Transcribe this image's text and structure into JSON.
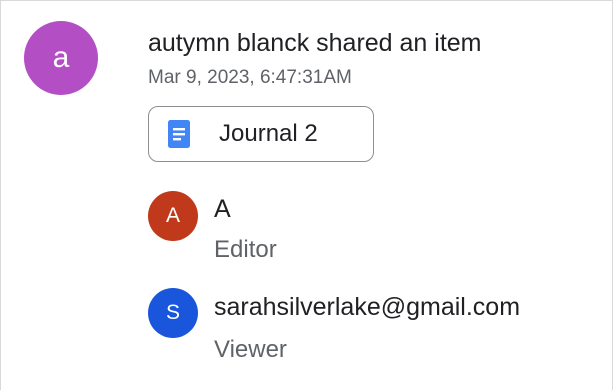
{
  "activity": {
    "actor_initial": "a",
    "actor_avatar_color": "#b44ec5",
    "title": "autymn blanck shared an item",
    "timestamp": "Mar 9, 2023, 6:47:31AM"
  },
  "item": {
    "icon": "google-docs-icon",
    "icon_color": "#4285f4",
    "name": "Journal 2"
  },
  "people": [
    {
      "initial": "A",
      "avatar_color": "#c0391b",
      "name": "A",
      "role": "Editor"
    },
    {
      "initial": "S",
      "avatar_color": "#1a56db",
      "name": "sarahsilverlake@gmail.com",
      "role": "Viewer"
    }
  ]
}
